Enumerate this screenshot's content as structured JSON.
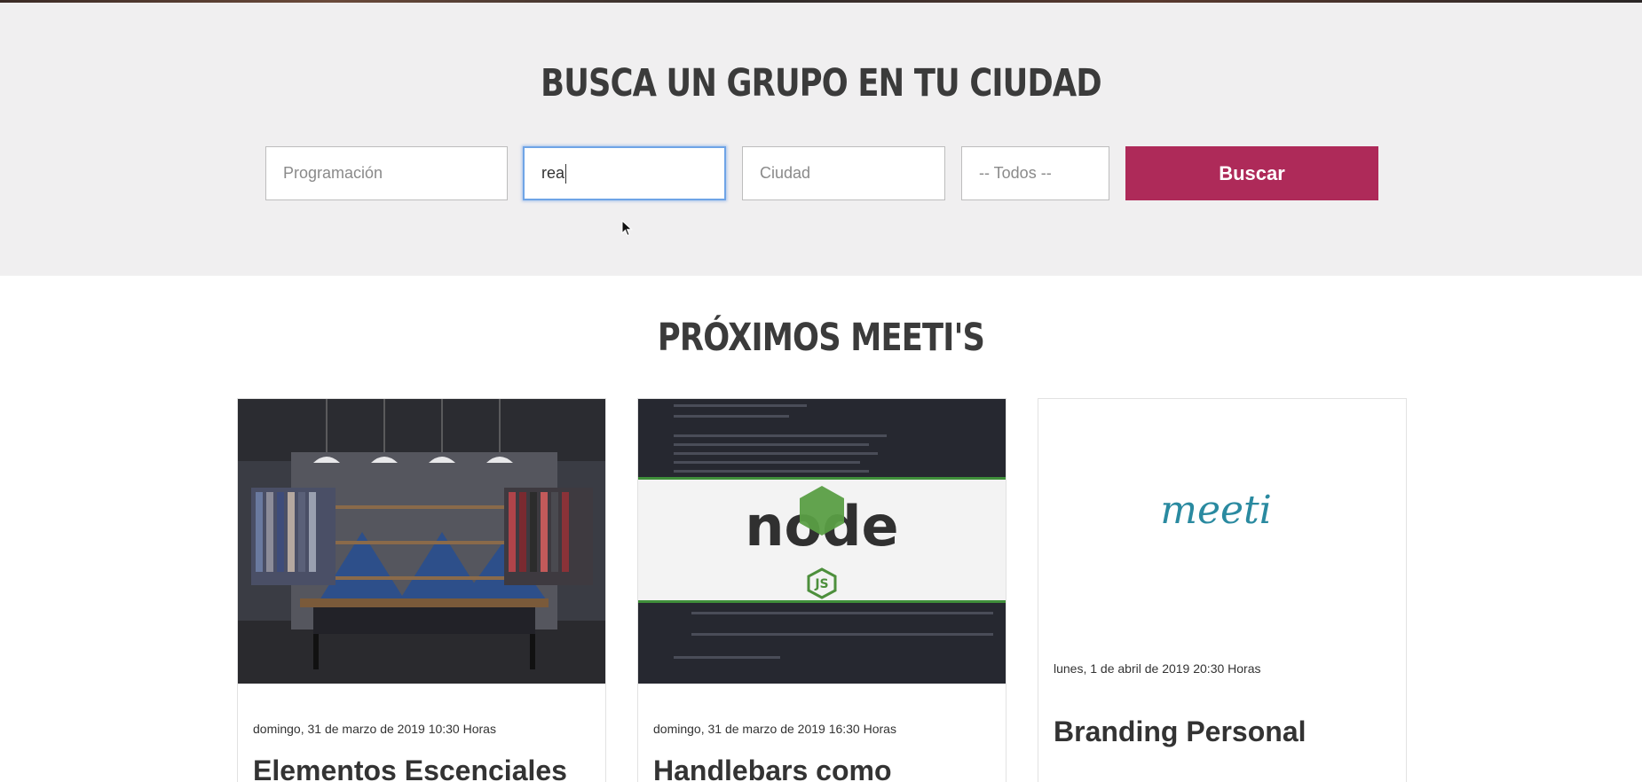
{
  "search": {
    "title": "Busca un grupo en tu ciudad",
    "category_placeholder": "Programación",
    "query_value": "rea",
    "city_placeholder": "Ciudad",
    "filter_selected": "-- Todos --",
    "button_label": "Buscar"
  },
  "upcoming": {
    "title": "Próximos Meeti's",
    "cards": [
      {
        "date": "domingo, 31 de marzo de 2019 10:30 Horas",
        "title": "Elementos Escenciales",
        "image": "clothing-store-photo"
      },
      {
        "date": "domingo, 31 de marzo de 2019 16:30 Horas",
        "title": "Handlebars como",
        "image": "nodejs-logo",
        "logo_text": "node",
        "logo_badge": "JS"
      },
      {
        "date": "lunes, 1 de abril de 2019 20:30 Horas",
        "title": "Branding Personal",
        "image": "meeti-logo",
        "logo_text": "meeti"
      }
    ]
  },
  "colors": {
    "accent": "#ae2a59",
    "search_bg": "#f0eff0",
    "heading": "#3b3b3b",
    "node_green": "#3f8f3a",
    "meeti_teal": "#2a8aa0"
  }
}
